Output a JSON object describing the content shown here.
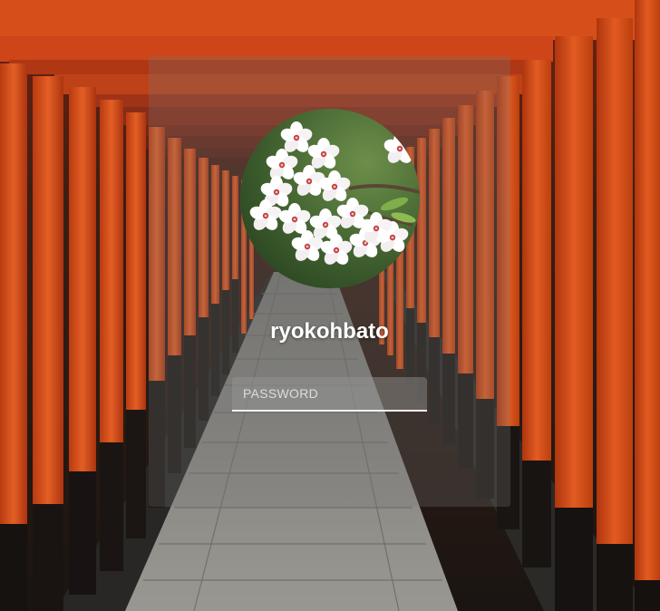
{
  "user": {
    "username": "ryokohbato"
  },
  "login": {
    "password_placeholder": "PASSWORD"
  },
  "background": {
    "subject": "torii-gates-path",
    "colors": {
      "torii": "#e8521f",
      "pillar_base": "#1a1614",
      "path": "#8e8c86"
    }
  },
  "avatar": {
    "subject": "cherry-blossom"
  }
}
